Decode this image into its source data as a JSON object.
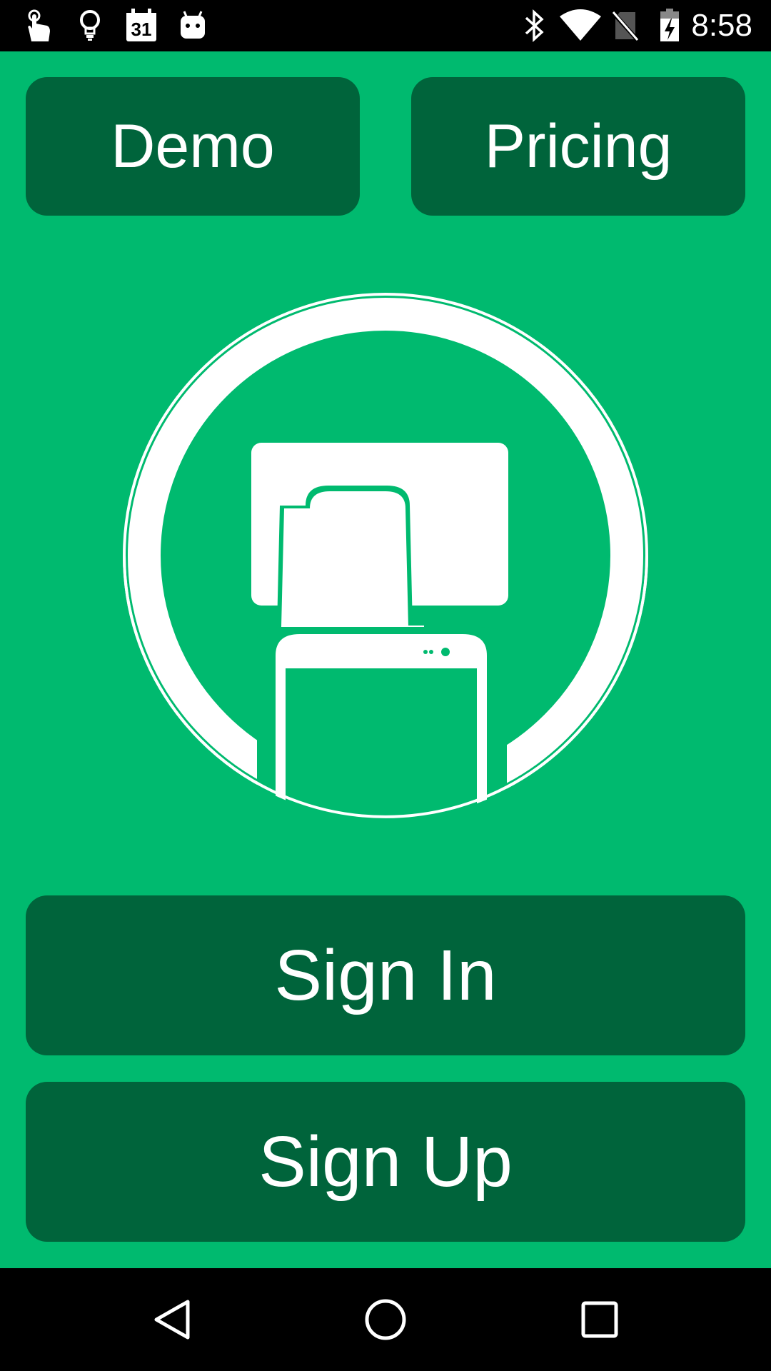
{
  "status_bar": {
    "time": "8:58",
    "calendar_day": "31",
    "left_icons": [
      "touch-hand-icon",
      "lightbulb-icon",
      "calendar-icon",
      "android-icon"
    ],
    "right_icons": [
      "bluetooth-icon",
      "wifi-icon",
      "no-sim-icon",
      "battery-charging-icon"
    ]
  },
  "main": {
    "demo_label": "Demo",
    "pricing_label": "Pricing",
    "sign_in_label": "Sign In",
    "sign_up_label": "Sign Up",
    "logo": "tablet-phone-logo"
  },
  "colors": {
    "background": "#00BA6F",
    "button": "#00643B",
    "text": "#FFFFFF"
  },
  "nav_bar": {
    "icons": [
      "back-icon",
      "home-icon",
      "recents-icon"
    ]
  }
}
